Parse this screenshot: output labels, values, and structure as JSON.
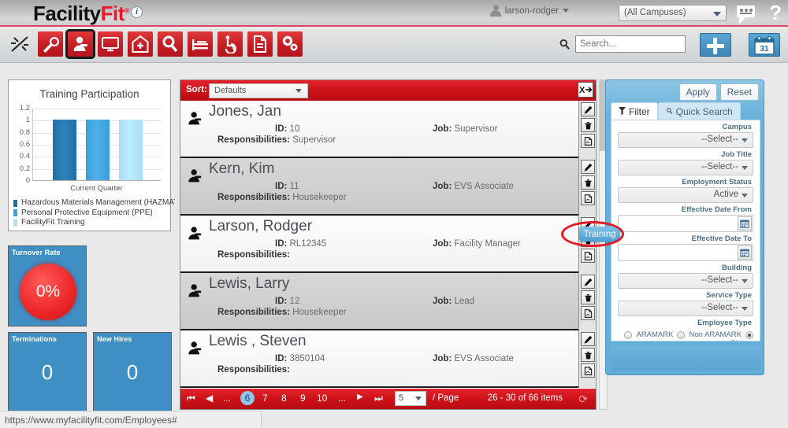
{
  "header": {
    "logo_primary": "Facility",
    "logo_accent": "Fit",
    "logo_tm": "®",
    "info_icon": "i",
    "user_name": "larson-rodger",
    "campus_value": "(All Campuses)",
    "help_label": "?"
  },
  "toolbar": {
    "icons": [
      {
        "name": "broken-link-icon",
        "label": "Disconnected"
      },
      {
        "name": "wrench-icon",
        "label": "Maintenance"
      },
      {
        "name": "employee-icon",
        "label": "Employees"
      },
      {
        "name": "monitor-icon",
        "label": "Equipment"
      },
      {
        "name": "hospital-icon",
        "label": "Facilities"
      },
      {
        "name": "magnifier-icon",
        "label": "Inspections"
      },
      {
        "name": "bed-icon",
        "label": "Beds"
      },
      {
        "name": "wheelchair-icon",
        "label": "Accessibility"
      },
      {
        "name": "document-icon",
        "label": "Reports"
      },
      {
        "name": "gears-icon",
        "label": "Settings"
      }
    ],
    "search_placeholder": "Search...",
    "add_label": "+",
    "calendar_label": "31"
  },
  "chart_data": {
    "type": "bar",
    "title": "Training Participation",
    "categories": [
      "Current Quarter"
    ],
    "series": [
      {
        "name": "Hazardous Materials Management (HAZMAT",
        "values": [
          1
        ],
        "color": "#1f6fa8"
      },
      {
        "name": "Personal Protective Equipment (PPE)",
        "values": [
          1
        ],
        "color": "#3a9fd9"
      },
      {
        "name": "FacilityFit Training",
        "values": [
          1
        ],
        "color": "#a9dcf5"
      }
    ],
    "xlabel": "Current Quarter",
    "ylabel": "",
    "ylim": [
      0,
      1.2
    ],
    "yticks": [
      "1.2",
      "1",
      "0.8",
      "0.6",
      "0.4",
      "0.2",
      "0"
    ],
    "grid": true,
    "legend_position": "bottom"
  },
  "tiles": [
    {
      "name": "turnover-rate-tile",
      "label": "Turnover Rate",
      "value": "0%",
      "style": "donut"
    },
    {
      "name": "terminations-tile",
      "label": "Terminations",
      "value": "0",
      "style": "plain"
    },
    {
      "name": "new-hires-tile",
      "label": "New Hires",
      "value": "0",
      "style": "plain"
    }
  ],
  "list": {
    "sort_label": "Sort:",
    "sort_value": "Defaults",
    "export_icon": "excel-export-icon",
    "labels": {
      "id": "ID:",
      "responsibilities": "Responsibilities:",
      "job": "Job:"
    },
    "rows": [
      {
        "name": "Jones, Jan",
        "id": "10",
        "responsibilities": "Supervisor",
        "job": "Supervisor"
      },
      {
        "name": "Kern, Kim",
        "id": "11",
        "responsibilities": "Housekeeper",
        "job": "EVS Associate"
      },
      {
        "name": "Larson, Rodger",
        "id": "RL12345",
        "responsibilities": "",
        "job": "Facility Manager"
      },
      {
        "name": "Lewis, Larry",
        "id": "12",
        "responsibilities": "Housekeeper",
        "job": "Lead"
      },
      {
        "name": "Lewis , Steven",
        "id": "3850104",
        "responsibilities": "",
        "job": "EVS Associate"
      }
    ],
    "row_actions": [
      {
        "name": "edit-row-button",
        "glyph": "✎"
      },
      {
        "name": "delete-row-button",
        "glyph": "🗑"
      },
      {
        "name": "training-row-button",
        "glyph": "🗎"
      }
    ]
  },
  "pagination": {
    "first": "⏮",
    "prev": "◀",
    "ellipsis_left": "...",
    "pages": [
      "6",
      "7",
      "8",
      "9",
      "10"
    ],
    "current_page": "6",
    "ellipsis_right": "...",
    "next": "▶",
    "last": "⏭",
    "per_page_value": "5",
    "per_page_label": "/ Page",
    "items_label": "26 - 30 of 66 items",
    "refresh_icon": "refresh-icon"
  },
  "filter": {
    "apply_label": "Apply",
    "reset_label": "Reset",
    "tabs": [
      {
        "name": "tab-filter",
        "label": "Filter",
        "icon": "funnel-icon",
        "active": true
      },
      {
        "name": "tab-quick-search",
        "label": "Quick Search",
        "icon": "search-icon",
        "active": false
      }
    ],
    "fields": [
      {
        "name": "campus-filter",
        "label": "Campus",
        "value": "--Select--",
        "kind": "select"
      },
      {
        "name": "job-title-filter",
        "label": "Job Title",
        "value": "--Select--",
        "kind": "select"
      },
      {
        "name": "employment-status-filter",
        "label": "Employment Status",
        "value": "Active",
        "kind": "select"
      },
      {
        "name": "effective-date-from-filter",
        "label": "Effective Date From",
        "value": "",
        "kind": "date"
      },
      {
        "name": "effective-date-to-filter",
        "label": "Effective Date To",
        "value": "",
        "kind": "date"
      },
      {
        "name": "building-filter",
        "label": "Building",
        "value": "--Select--",
        "kind": "select"
      },
      {
        "name": "service-type-filter",
        "label": "Service Type",
        "value": "--Select--",
        "kind": "select"
      }
    ],
    "employee_type": {
      "label": "Employee Type",
      "options": [
        "ARAMARK",
        "Non ARAMARK"
      ],
      "selected": "Either",
      "selected_label": "Either"
    }
  },
  "annotation": {
    "tooltip_text": "Training",
    "highlight_color": "#e01b24"
  },
  "status_bar": {
    "url": "https://www.myfacilityfit.com/Employees#"
  },
  "colors": {
    "brand_red": "#cc1017",
    "accent_blue": "#3f8fc4",
    "panel_blue": "#63add8"
  }
}
